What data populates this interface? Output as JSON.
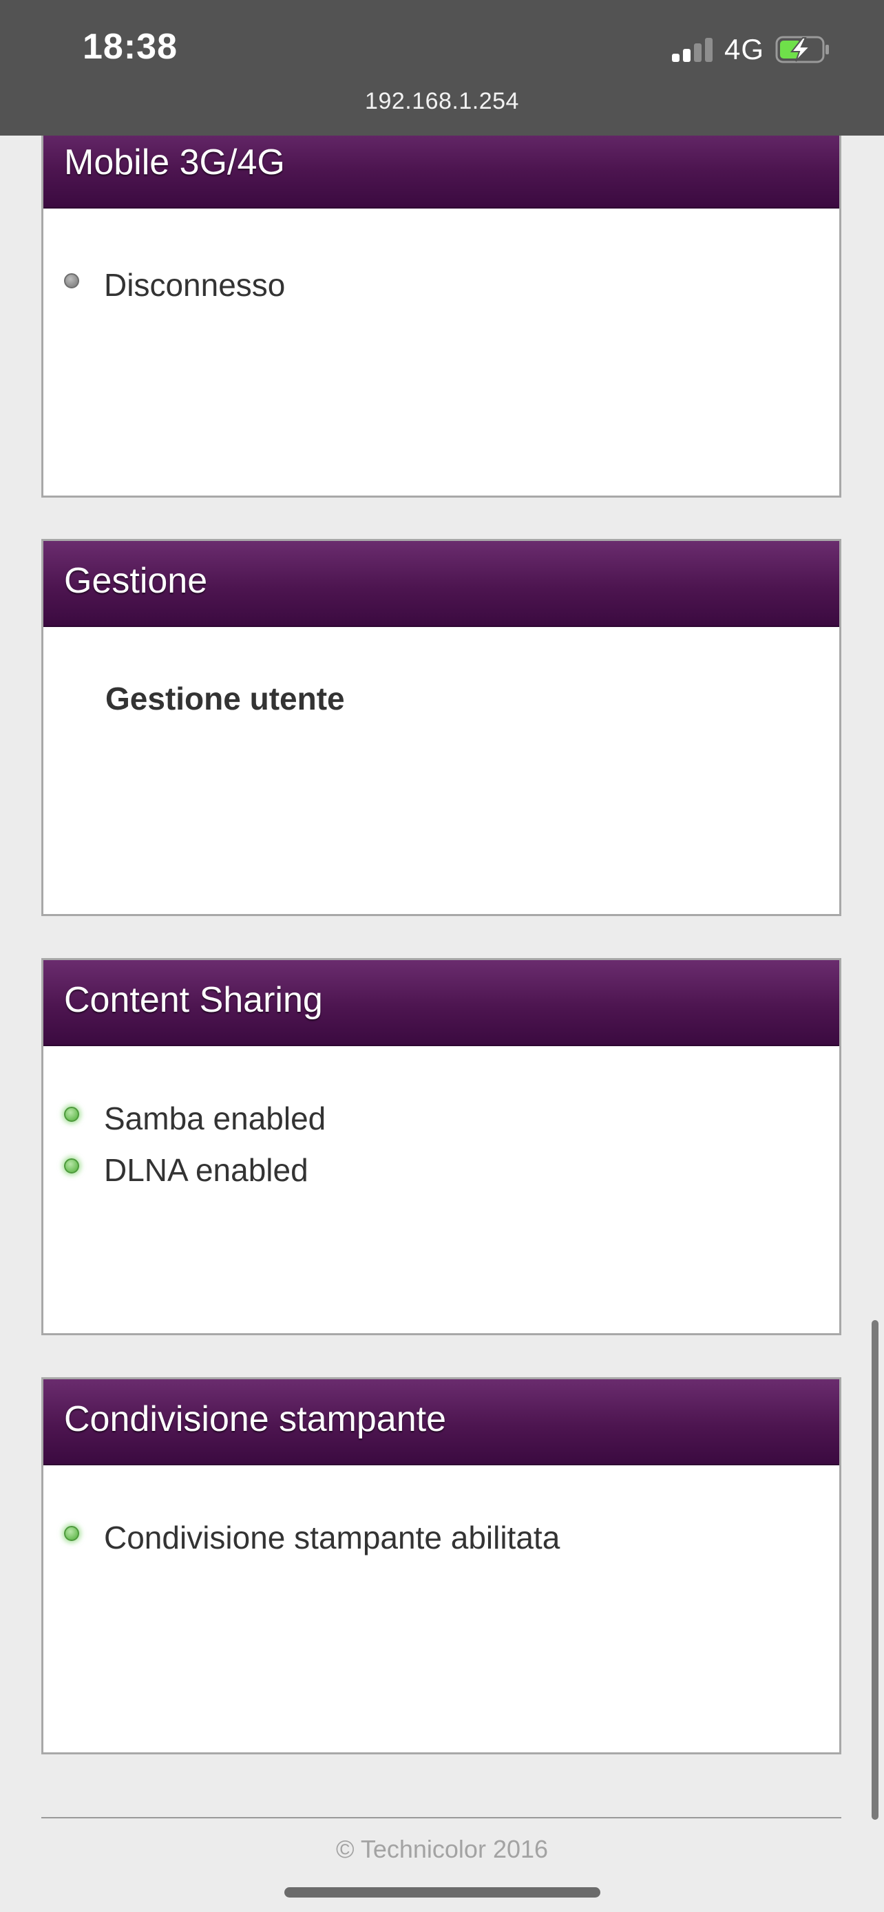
{
  "status_bar": {
    "time": "18:38",
    "network": "4G",
    "signal_bars": 2,
    "signal_bars_total": 4,
    "battery_level": 0.5,
    "battery_charging": true,
    "battery_color": "#6fe04a"
  },
  "browser": {
    "url": "192.168.1.254"
  },
  "cards": {
    "mobile": {
      "title": "Mobile 3G/4G",
      "status_label": "Disconnesso",
      "status": "gray"
    },
    "gestione": {
      "title": "Gestione",
      "link_label": "Gestione utente"
    },
    "content_sharing": {
      "title": "Content Sharing",
      "items": [
        {
          "label": "Samba enabled",
          "status": "green"
        },
        {
          "label": "DLNA enabled",
          "status": "green"
        }
      ]
    },
    "printer": {
      "title": "Condivisione stampante",
      "status_label": "Condivisione stampante abilitata",
      "status": "green"
    }
  },
  "footer": {
    "text": "© Technicolor 2016"
  },
  "colors": {
    "header_top": "#6a2c6e",
    "header_bottom": "#3b0a40",
    "status_green": "#6fc05a",
    "status_gray": "#8a8a8a",
    "page_background": "#ececec"
  }
}
